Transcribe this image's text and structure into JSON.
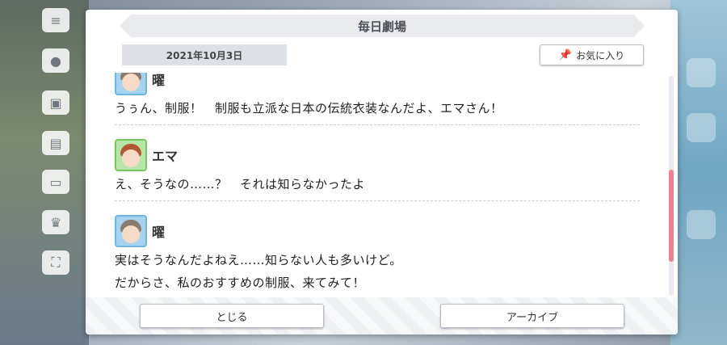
{
  "dialog": {
    "title": "毎日劇場",
    "date": "2021年10月3日",
    "favorite_label": "お気に入り",
    "close_label": "とじる",
    "archive_label": "アーカイブ"
  },
  "messages": [
    {
      "speaker": "曜",
      "lines": [
        "うぅん、制服！　制服も立派な日本の伝統衣装なんだよ、エマさん！"
      ]
    },
    {
      "speaker": "エマ",
      "lines": [
        "え、そうなの……？　それは知らなかったよ"
      ]
    },
    {
      "speaker": "曜",
      "lines": [
        "実はそうなんだよねえ……知らない人も多いけど。",
        "だからさ、私のおすすめの制服、来てみて！"
      ]
    }
  ],
  "scroll_position_fraction": 0.43,
  "colors": {
    "scroll_thumb": "#f0808f",
    "avatar_you": "#a6d3ef",
    "avatar_emma": "#b9e6a8"
  }
}
